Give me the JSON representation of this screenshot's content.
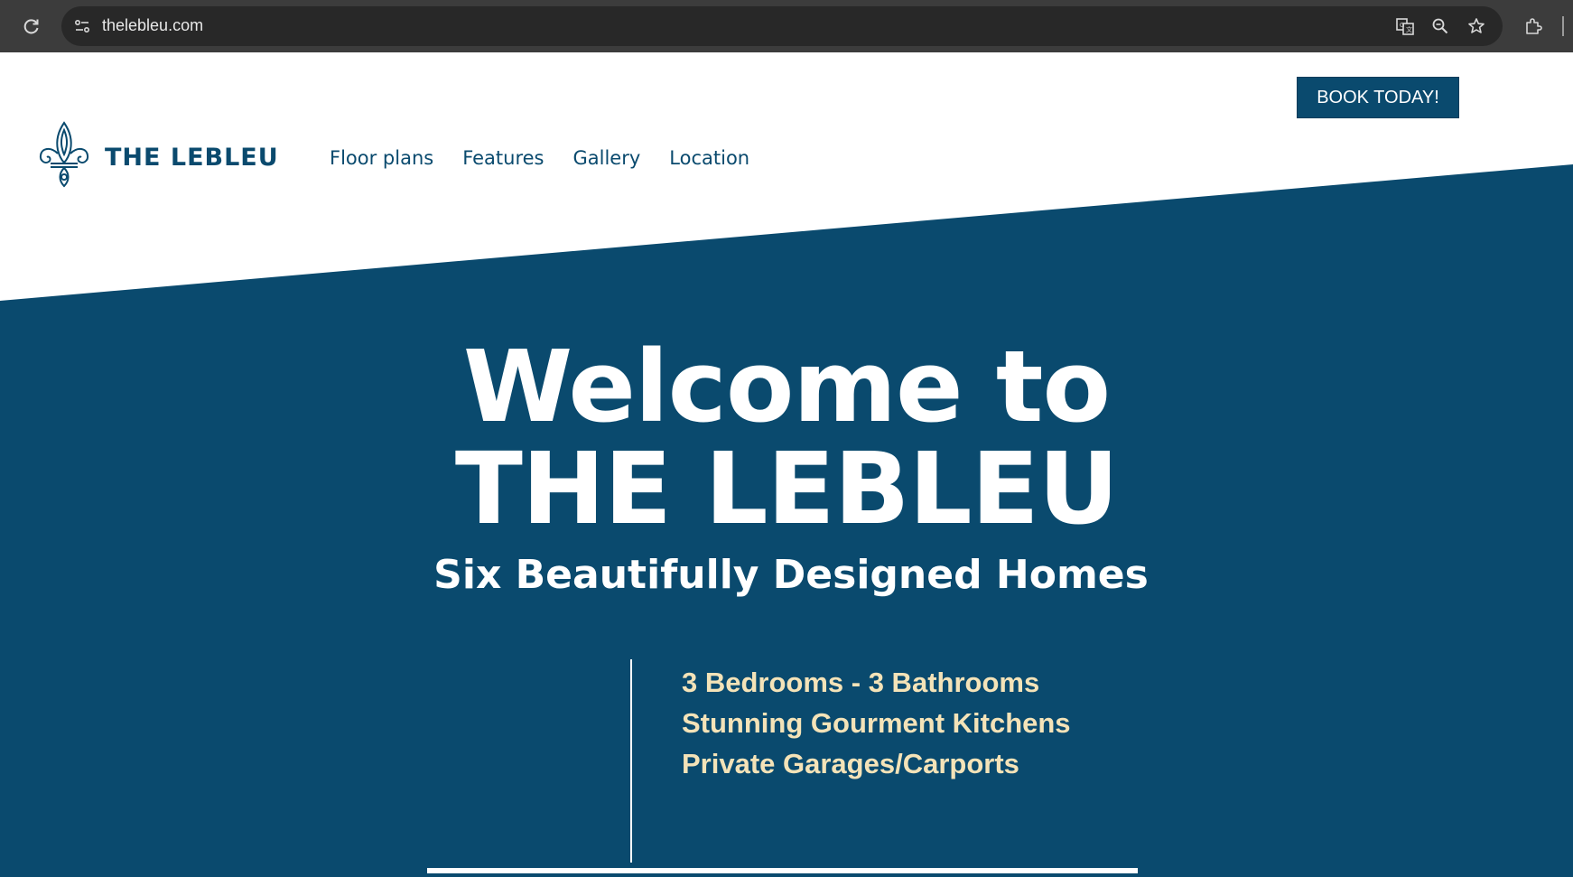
{
  "browser": {
    "url": "thelebleu.com",
    "icons": [
      "reload-icon",
      "site-info-icon",
      "translate-icon",
      "zoom-icon",
      "bookmark-star-icon",
      "extensions-icon"
    ]
  },
  "header": {
    "book_button": "BOOK TODAY!",
    "brand": "THE LEBLEU",
    "nav": [
      "Floor plans",
      "Features",
      "Gallery",
      "Location"
    ]
  },
  "hero": {
    "title_line1": "Welcome to",
    "title_line2": "THE LEBLEU",
    "subtitle": "Six Beautifully Designed Homes",
    "features": [
      "3 Bedrooms - 3 Bathrooms",
      "Stunning Gourment Kitchens",
      "Private Garages/Carports"
    ]
  },
  "colors": {
    "brand_blue": "#0a4a6e",
    "feature_text": "#f4e3b8",
    "chrome_bg": "#3c3c3c"
  }
}
